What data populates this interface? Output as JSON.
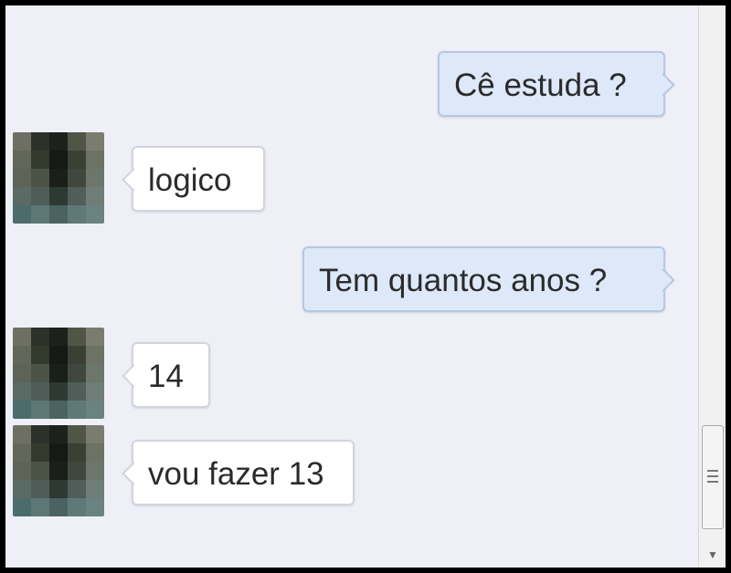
{
  "messages": [
    {
      "side": "out",
      "text": "Cê estuda ?"
    },
    {
      "side": "in",
      "text": "logico"
    },
    {
      "side": "out",
      "text": "Tem quantos anos ?"
    },
    {
      "side": "in",
      "text": "14"
    },
    {
      "side": "in",
      "text": "vou fazer 13"
    }
  ],
  "avatar_pixelation": [
    "#6e6f63",
    "#2d3129",
    "#1d211b",
    "#505546",
    "#7a7c6f",
    "#62675a",
    "#353a2f",
    "#161915",
    "#3b4034",
    "#6d7265",
    "#5d6457",
    "#4b5246",
    "#1b1f19",
    "#40473c",
    "#6c766b",
    "#5a6a64",
    "#4e5d57",
    "#2d3932",
    "#4f5e58",
    "#6f7d77",
    "#4c6c6c",
    "#5c7776",
    "#4a6262",
    "#5f7978",
    "#6a8281"
  ],
  "scrollbar": {
    "down_arrow": "▼"
  }
}
